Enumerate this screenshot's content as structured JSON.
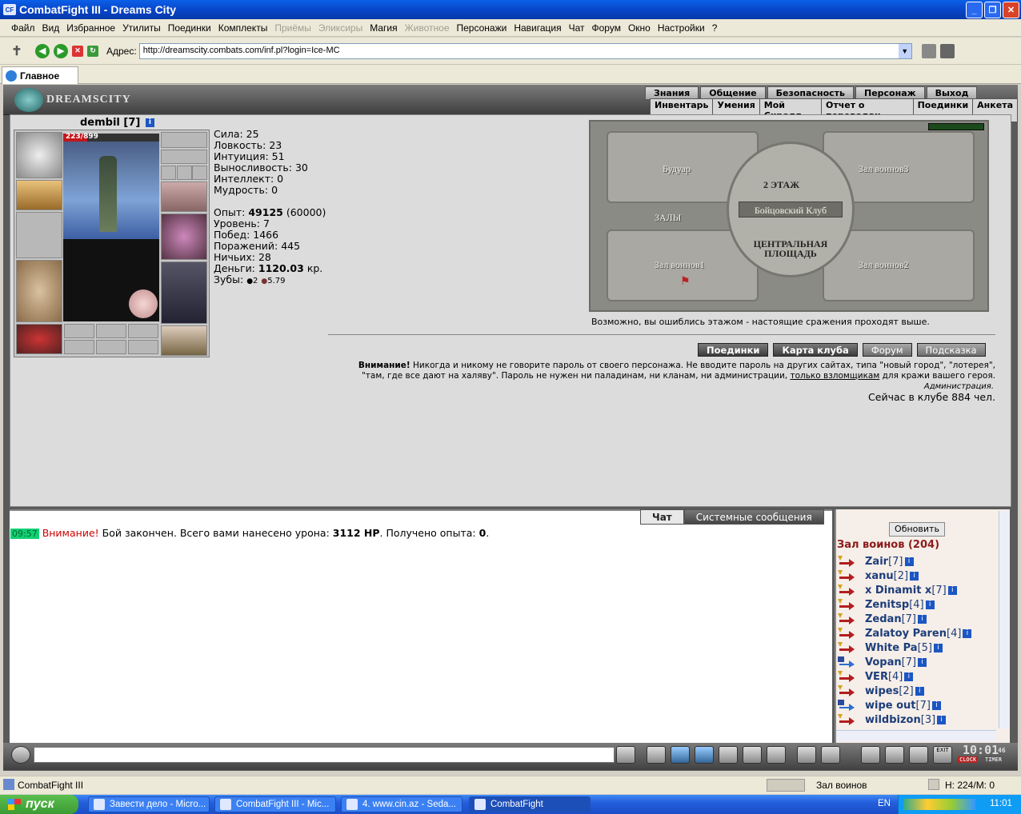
{
  "window": {
    "title": "CombatFight III - Dreams City",
    "app_icon": "CF"
  },
  "menu": {
    "items": [
      "Файл",
      "Вид",
      "Избранное",
      "Утилиты",
      "Поединки",
      "Комплекты",
      "Приёмы",
      "Эликсиры",
      "Магия",
      "Животное",
      "Персонажи",
      "Навигация",
      "Чат",
      "Форум",
      "Окно",
      "Настройки",
      "?"
    ],
    "disabled": [
      "Приёмы",
      "Эликсиры",
      "Животное"
    ]
  },
  "toolbar": {
    "address_label": "Адрес:",
    "address": "http://dreamscity.combats.com/inf.pl?login=Ice-MC"
  },
  "tabs": {
    "main": "Главное"
  },
  "site": {
    "logo": "DREAMSCITY",
    "nav_top": [
      "Знания",
      "Общение",
      "Безопасность",
      "Персонаж",
      "Выход"
    ],
    "nav_bottom": [
      "Инвентарь",
      "Умения",
      "Мой Скролл",
      "Отчет о переводах",
      "Поединки",
      "Анкета"
    ]
  },
  "character": {
    "name": "dembil",
    "level": "[7]",
    "hp": "223/899",
    "hp_fraction": 0.248
  },
  "stats": {
    "strength": "Сила: 25",
    "agility": "Ловкость: 23",
    "intuition": "Интуиция: 51",
    "endurance": "Выносливость: 30",
    "intellect": "Интеллект: 0",
    "wisdom": "Мудрость: 0",
    "exp_label": "Опыт:",
    "exp": "49125",
    "exp_next": "(60000)",
    "level": "Уровень: 7",
    "wins": "Побед: 1466",
    "losses": "Поражений: 445",
    "draws": "Ничьих: 28",
    "money_label": "Деньги:",
    "money": "1120.03",
    "money_unit": "кр.",
    "teeth_label": "Зубы:",
    "teeth_a": "2",
    "teeth_b": "5.79"
  },
  "map": {
    "boudoir": "Будуар",
    "hall3": "Зал воинов3",
    "floor": "2 ЭТАЖ",
    "club": "Бойцовский Клуб",
    "halls": "ЗАЛЫ",
    "central": "ЦЕНТРАЛЬНАЯ ПЛОЩАДЬ",
    "hall1": "Зал воинов1",
    "hall2": "Зал воинов2",
    "hint": "Возможно, вы ошиблись этажом - настоящие сражения проходят выше."
  },
  "buttons": {
    "duels": "Поединки",
    "club_map": "Карта клуба",
    "forum": "Форум",
    "hint": "Подсказка"
  },
  "warning": {
    "bold": "Внимание!",
    "line1": " Никогда и никому не говорите пароль от своего персонажа. Не вводите пароль на других сайтах, типа \"новый город\", \"лотерея\",",
    "line2": "\"там, где все дают на халяву\". Пароль не нужен ни паладинам, ни кланам, ни администрации, ",
    "link": "только взломщикам",
    "line2_end": " для кражи вашего героя.",
    "admin": "Администрация.",
    "online": "Сейчас в клубе 884 чел."
  },
  "chat": {
    "tab_chat": "Чат",
    "tab_system": "Системные сообщения",
    "time": "09:57",
    "msg_red": "Внимание!",
    "msg1": " Бой закончен. Всего вами нанесено урона: ",
    "damage": "3112 HP",
    "msg2": ". Получено опыта: ",
    "exp_gained": "0",
    "msg_end": "."
  },
  "sidebar": {
    "refresh": "Обновить",
    "hall": "Зал воинов (204)",
    "players": [
      {
        "name": "Zair",
        "level": "[7]",
        "icon": "fight"
      },
      {
        "name": "xanu",
        "level": "[2]",
        "icon": "fight"
      },
      {
        "name": "x Dinamit x",
        "level": "[7]",
        "icon": "fight"
      },
      {
        "name": "Zenitsp",
        "level": "[4]",
        "icon": "fight"
      },
      {
        "name": "Zedan",
        "level": "[7]",
        "icon": "fight"
      },
      {
        "name": "Zalatoy Paren",
        "level": "[4]",
        "icon": "fight"
      },
      {
        "name": "White Pa",
        "level": "[5]",
        "icon": "fight"
      },
      {
        "name": "Vopan",
        "level": "[7]",
        "icon": "travel"
      },
      {
        "name": "VER",
        "level": "[4]",
        "icon": "fight"
      },
      {
        "name": "wipes",
        "level": "[2]",
        "icon": "fight"
      },
      {
        "name": "wipe out",
        "level": "[7]",
        "icon": "travel"
      },
      {
        "name": "wildbizon",
        "level": "[3]",
        "icon": "fight"
      }
    ]
  },
  "clock": {
    "time": "10:01",
    "sec": "46",
    "clock_label": "CLOCK",
    "timer_label": "TIMER",
    "exit": "EXIT"
  },
  "statusbar": {
    "left": "CombatFight III",
    "location": "Зал воинов",
    "hm": "H: 224/M: 0"
  },
  "taskbar": {
    "start": "пуск",
    "tasks": [
      "Завести дело - Micro...",
      "CombatFight III - Mic...",
      "4. www.cin.az - Seda...",
      "CombatFight"
    ],
    "lang": "EN",
    "time": "11:01"
  },
  "colors": {
    "title_blue": "#0842c4",
    "hp_red": "#c3151b",
    "time_green": "#12d072",
    "hall_red": "#8b1a1a",
    "player_blue": "#1c3d7a"
  }
}
